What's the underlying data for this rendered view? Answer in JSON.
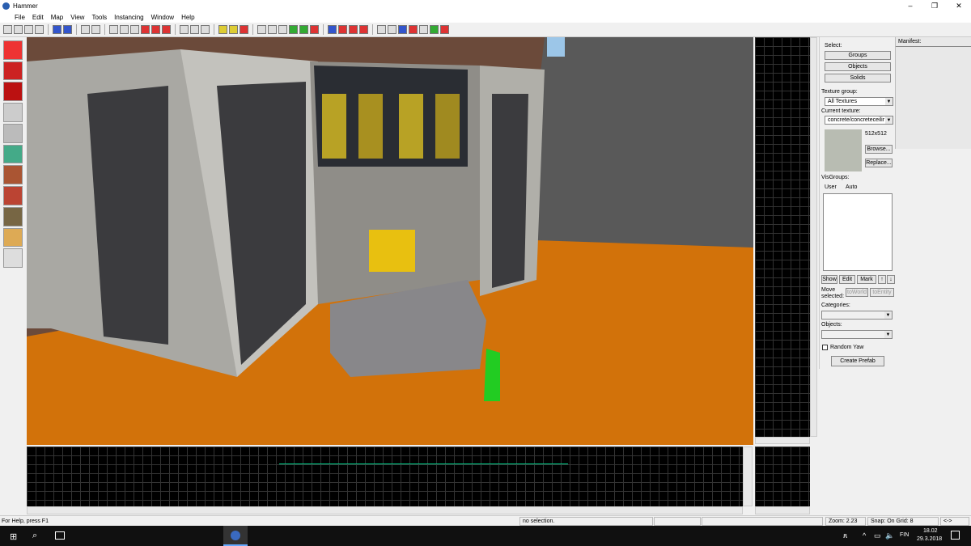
{
  "window": {
    "title": "Hammer",
    "minimize": "–",
    "maximize": "❐",
    "close": "✕"
  },
  "menu": [
    "File",
    "Edit",
    "Map",
    "View",
    "Tools",
    "Instancing",
    "Window",
    "Help"
  ],
  "panel": {
    "select_label": "Select:",
    "groups": "Groups",
    "objects": "Objects",
    "solids": "Solids",
    "texture_group_label": "Texture group:",
    "texture_group_value": "All Textures",
    "current_texture_label": "Current texture:",
    "current_texture_value": "concrete/concreteceilir",
    "texture_size": "512x512",
    "browse": "Browse...",
    "replace": "Replace...",
    "visgroups_label": "VisGroups:",
    "tab_user": "User",
    "tab_auto": "Auto",
    "show": "Show",
    "edit": "Edit",
    "mark": "Mark",
    "up": "↑",
    "down": "↓",
    "move_selected": "Move selected:",
    "to_world": "toWorld",
    "to_entity": "toEntity",
    "categories_label": "Categories:",
    "objects_label": "Objects:",
    "random_yaw": "Random Yaw",
    "create_prefab": "Create Prefab"
  },
  "manifest": {
    "label": "Manifest:"
  },
  "status": {
    "help": "For Help, press F1",
    "selection": "no selection.",
    "zoom": "Zoom: 2.23",
    "snap": "Snap: On Grid: 8",
    "arrows": "<->"
  },
  "taskbar": {
    "lang": "FIN",
    "time": "18.02",
    "date": "29.3.2018"
  }
}
